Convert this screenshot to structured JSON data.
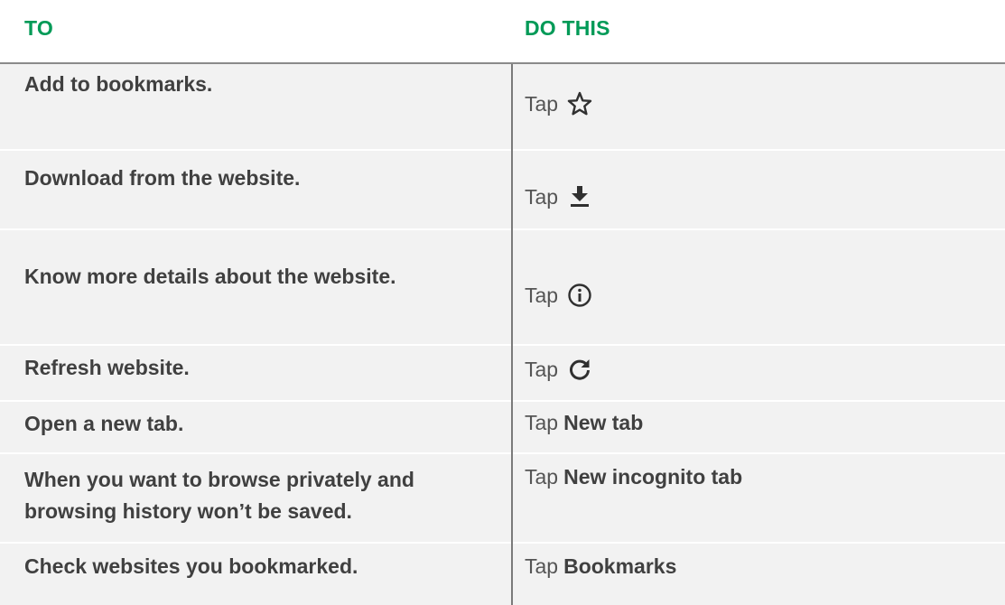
{
  "header": {
    "col_to": "TO",
    "col_do": "DO THIS"
  },
  "rows": [
    {
      "to": "Add to bookmarks.",
      "tap": "Tap",
      "icon": "star-outline-icon"
    },
    {
      "to": "Download from the website.",
      "tap": "Tap",
      "icon": "download-icon"
    },
    {
      "to": "Know more details about the website.",
      "tap": "Tap",
      "icon": "info-circle-icon"
    },
    {
      "to": "Refresh website.",
      "tap": "Tap",
      "icon": "refresh-icon"
    },
    {
      "to": "Open a new tab.",
      "tap": "Tap",
      "action": "New tab"
    },
    {
      "to_line1": "When you want to browse privately and",
      "to_line2": "browsing history won’t be saved.",
      "tap": "Tap",
      "action": "New incognito tab"
    },
    {
      "to": "Check websites you bookmarked.",
      "tap": "Tap",
      "action": "Bookmarks"
    }
  ],
  "colors": {
    "header_text": "#009a57",
    "row_bg": "#f2f2f2",
    "body_text": "#404040"
  }
}
